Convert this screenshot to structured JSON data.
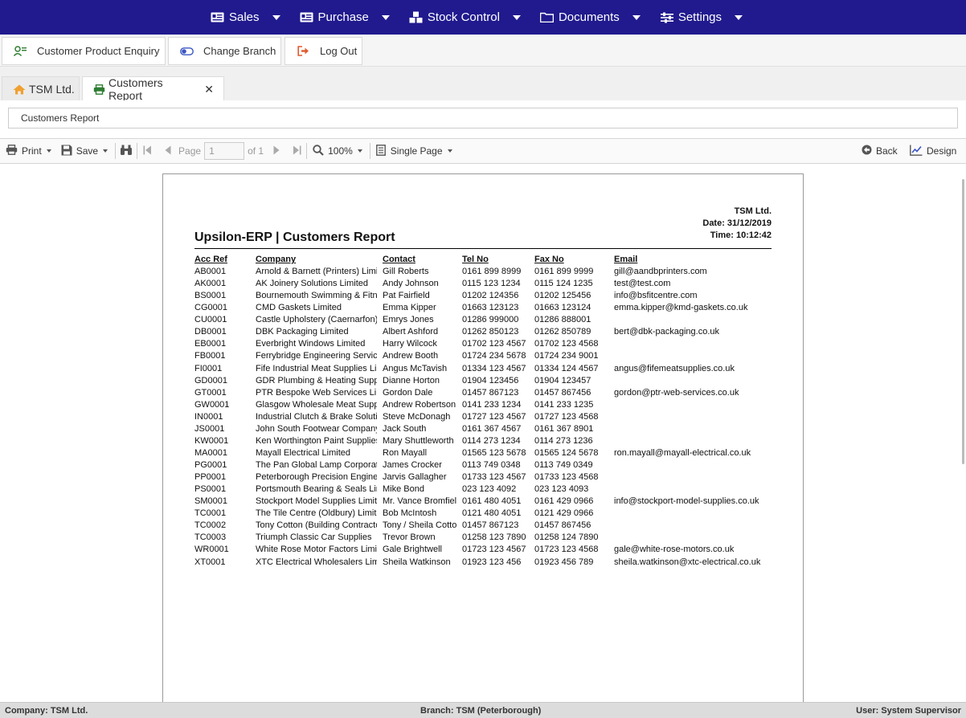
{
  "nav": {
    "menus": [
      {
        "label": "Sales",
        "icon": "sales-icon"
      },
      {
        "label": "Purchase",
        "icon": "purchase-icon"
      },
      {
        "label": "Stock Control",
        "icon": "stock-icon"
      },
      {
        "label": "Documents",
        "icon": "folder-icon"
      },
      {
        "label": "Settings",
        "icon": "sliders-icon"
      }
    ]
  },
  "actions": {
    "customer_product_enquiry": "Customer Product Enquiry",
    "change_branch": "Change Branch",
    "log_out": "Log Out"
  },
  "tabs": {
    "home": "TSM Ltd.",
    "report": "Customers Report"
  },
  "report_title_field": "Customers Report",
  "toolbar": {
    "print": "Print",
    "save": "Save",
    "page_label": "Page",
    "page_value": "1",
    "of_label": "of 1",
    "zoom": "100%",
    "view_mode": "Single Page",
    "back": "Back",
    "design": "Design"
  },
  "report": {
    "company": "TSM Ltd.",
    "date": "Date: 31/12/2019",
    "time": "Time: 10:12:42",
    "title": "Upsilon-ERP | Customers Report",
    "columns": [
      "Acc Ref",
      "Company",
      "Contact",
      "Tel No",
      "Fax No",
      "Email"
    ],
    "rows": [
      [
        "AB0001",
        "Arnold & Barnett (Printers) Limit",
        "Gill Roberts",
        "0161 899 8999",
        "0161 899 9999",
        "gill@aandbprinters.com"
      ],
      [
        "AK0001",
        "AK Joinery Solutions Limited",
        "Andy Johnson",
        "0115 123 1234",
        "0115 124 1235",
        "test@test.com"
      ],
      [
        "BS0001",
        "Bournemouth Swimming & Fitne",
        "Pat Fairfield",
        "01202 124356",
        "01202 125456",
        "info@bsfitcentre.com"
      ],
      [
        "CG0001",
        "CMD Gaskets Limited",
        "Emma Kipper",
        "01663 123123",
        "01663 123124",
        "emma.kipper@kmd-gaskets.co.uk"
      ],
      [
        "CU0001",
        "Castle Upholstery (Caernarfon)",
        "Emrys Jones",
        "01286 999000",
        "01286 888001",
        ""
      ],
      [
        "DB0001",
        "DBK Packaging Limited",
        "Albert Ashford",
        "01262 850123",
        "01262 850789",
        "bert@dbk-packaging.co.uk"
      ],
      [
        "EB0001",
        "Everbright Windows Limited",
        "Harry Wilcock",
        "01702 123 4567",
        "01702 123 4568",
        ""
      ],
      [
        "FB0001",
        "Ferrybridge Engineering Service",
        "Andrew Booth",
        "01724 234 5678",
        "01724 234 9001",
        ""
      ],
      [
        "FI0001",
        "Fife Industrial Meat Supplies Lin",
        "Angus McTavish",
        "01334 123 4567",
        "01334 124 4567",
        "angus@fifemeatsupplies.co.uk"
      ],
      [
        "GD0001",
        "GDR Plumbing & Heating Suppl",
        "Dianne Horton",
        "01904 123456",
        "01904 123457",
        ""
      ],
      [
        "GT0001",
        "PTR Bespoke Web Services Lin",
        "Gordon Dale",
        "01457 867123",
        "01457 867456",
        "gordon@ptr-web-services.co.uk"
      ],
      [
        "GW0001",
        "Glasgow Wholesale Meat Suppl",
        "Andrew Robertson",
        "0141 233 1234",
        "0141 233 1235",
        ""
      ],
      [
        "IN0001",
        "Industrial Clutch & Brake Solutic",
        "Steve McDonagh",
        "01727 123 4567",
        "01727 123 4568",
        ""
      ],
      [
        "JS0001",
        "John South Footwear Company",
        "Jack South",
        "0161 367 4567",
        "0161 367 8901",
        ""
      ],
      [
        "KW0001",
        "Ken Worthington Paint Supplies",
        "Mary Shuttleworth",
        "0114 273 1234",
        "0114 273 1236",
        ""
      ],
      [
        "MA0001",
        "Mayall Electrical Limited",
        "Ron Mayall",
        "01565 123 5678",
        "01565 124 5678",
        "ron.mayall@mayall-electrical.co.uk"
      ],
      [
        "PG0001",
        "The Pan Global Lamp Corporati",
        "James Crocker",
        "0113 749 0348",
        "0113 749 0349",
        ""
      ],
      [
        "PP0001",
        "Peterborough Precision Enginee",
        "Jarvis Gallagher",
        "01733 123 4567",
        "01733 123 4568",
        ""
      ],
      [
        "PS0001",
        "Portsmouth Bearing & Seals Lin",
        "Mike Bond",
        "023 123 4092",
        "023 123 4093",
        ""
      ],
      [
        "SM0001",
        "Stockport Model Supplies Limite",
        "Mr. Vance Bromfiel",
        "0161 480 4051",
        "0161 429 0966",
        "info@stockport-model-supplies.co.uk"
      ],
      [
        "TC0001",
        "The Tile Centre (Oldbury) Limite",
        "Bob McIntosh",
        "0121 480 4051",
        "0121 429 0966",
        ""
      ],
      [
        "TC0002",
        "Tony Cotton (Building Contracto",
        "Tony / Sheila Cotto",
        "01457 867123",
        "01457 867456",
        ""
      ],
      [
        "TC0003",
        "Triumph Classic Car Supplies",
        "Trevor Brown",
        "01258 123 7890",
        "01258 124 7890",
        ""
      ],
      [
        "WR0001",
        "White Rose Motor Factors Limit",
        "Gale Brightwell",
        "01723 123 4567",
        "01723 123 4568",
        "gale@white-rose-motors.co.uk"
      ],
      [
        "XT0001",
        "XTC Electrical Wholesalers Limi",
        "Sheila Watkinson",
        "01923 123 456",
        "01923 456 789",
        "sheila.watkinson@xtc-electrical.co.uk"
      ]
    ]
  },
  "status": {
    "company": "Company: TSM Ltd.",
    "branch": "Branch: TSM (Peterborough)",
    "user": "User: System Supervisor"
  },
  "colors": {
    "nav_bg": "#201a8e",
    "home_icon": "#f0a030",
    "report_tab_icon": "#2e7d32",
    "log_out_icon": "#e05a2b"
  }
}
